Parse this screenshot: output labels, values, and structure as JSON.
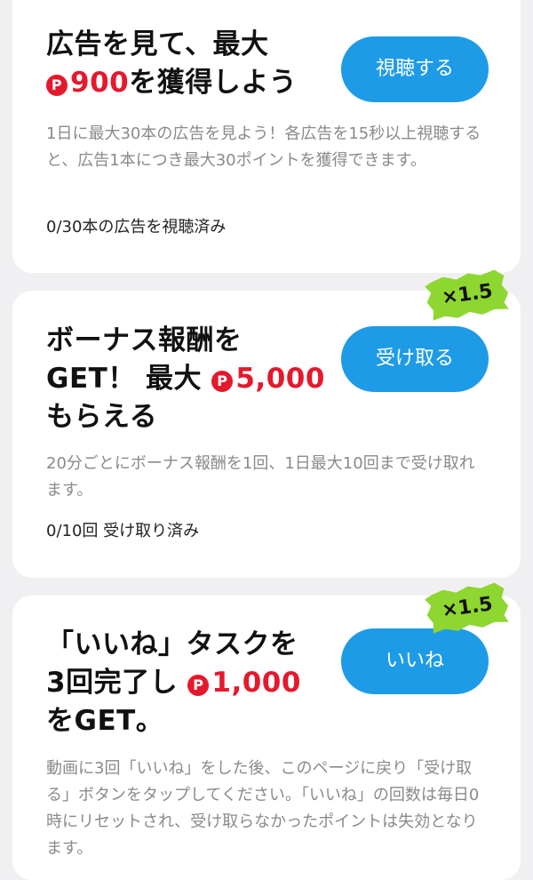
{
  "currency_symbol": "P",
  "tasks": [
    {
      "title_line1": "広告を見て、最大",
      "title_amount": "900",
      "title_suffix": "を獲得しよう",
      "button_label": "視聴する",
      "description": "1日に最大30本の広告を見よう！各広告を15秒以上視聴すると、広告1本につき最大30ポイントを獲得できます。",
      "status": "0/30本の広告を視聴済み"
    },
    {
      "badge": "×1.5",
      "title_line1": "ボーナス報酬を",
      "title_line2_prefix": "GET！ 最大",
      "title_amount": "5,000",
      "title_line3": "もらえる",
      "button_label": "受け取る",
      "description": "20分ごとにボーナス報酬を1回、1日最大10回まで受け取れます。",
      "status": "0/10回 受け取り済み"
    },
    {
      "badge": "×1.5",
      "title_line1": "「いいね」タスクを",
      "title_line2_prefix": "3回完了し",
      "title_amount": "1,000",
      "title_line3": "をGET。",
      "button_label": "いいね",
      "description": "動画に3回「いいね」をした後、このページに戻り「受け取る」ボタンをタップしてください。「いいね」の回数は毎日0時にリセットされ、受け取らなかったポイントは失効となります。"
    }
  ],
  "colors": {
    "accent_blue": "#1e9be6",
    "points_red": "#e5192c",
    "badge_green": "#8ed630",
    "background": "#f0f0f2"
  }
}
